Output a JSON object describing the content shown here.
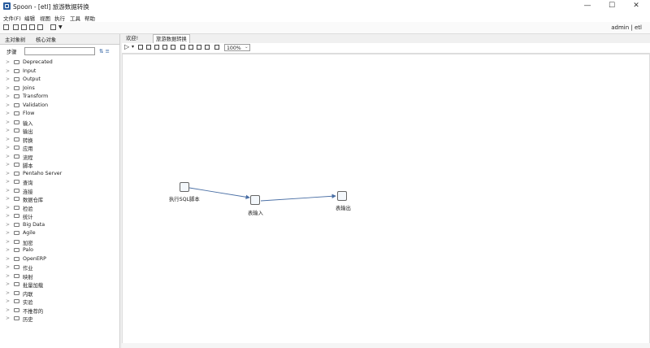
{
  "window": {
    "title": "Spoon - [etl] 旅游数据转换"
  },
  "menu": [
    "文件(F)",
    "编辑",
    "视图",
    "执行",
    "工具",
    "帮助"
  ],
  "user": {
    "label": "admin  |  etl"
  },
  "left_tabs": [
    "主对象树",
    "核心对象"
  ],
  "steps": {
    "label": "步骤",
    "search_placeholder": ""
  },
  "tree": [
    "Deprecated",
    "Input",
    "Output",
    "Joins",
    "Transform",
    "Validation",
    "Flow",
    "输入",
    "输出",
    "转换",
    "应用",
    "流程",
    "脚本",
    "Pentaho Server",
    "查询",
    "连接",
    "数据仓库",
    "检验",
    "统计",
    "Big Data",
    "Agile",
    "加密",
    "Palo",
    "OpenERP",
    "作业",
    "映射",
    "批量加载",
    "内联",
    "实验",
    "不推荐的",
    "历史"
  ],
  "right_tabs": [
    "欢迎!",
    "旅游数据转换"
  ],
  "zoom": "100%",
  "nodes": {
    "sql": "执行SQL脚本",
    "input": "表输入",
    "output": "表输出"
  }
}
